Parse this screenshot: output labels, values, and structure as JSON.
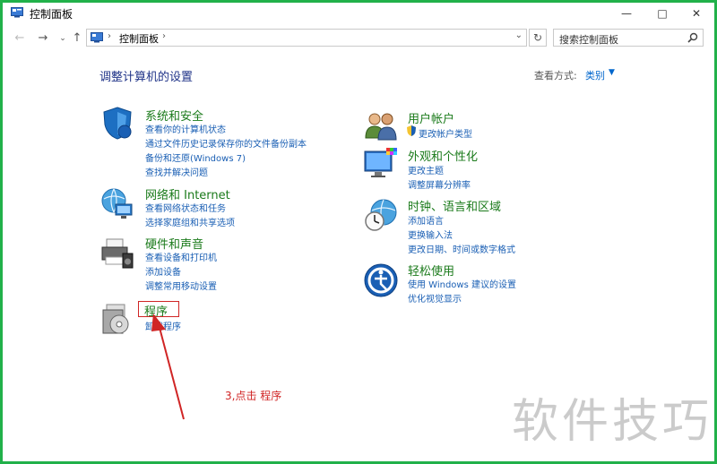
{
  "window": {
    "title": "控制面板",
    "buttons": {
      "minimize": "—",
      "maximize": "□",
      "close": "✕"
    }
  },
  "navbar": {
    "breadcrumb": "控制面板",
    "search_placeholder": "搜索控制面板"
  },
  "main": {
    "heading": "调整计算机的设置",
    "view_by_label": "查看方式:",
    "view_by_value": "类别"
  },
  "categories": [
    {
      "title": "系统和安全",
      "links": [
        "查看你的计算机状态",
        "通过文件历史记录保存你的文件备份副本",
        "备份和还原(Windows 7)",
        "查找并解决问题"
      ]
    },
    {
      "title": "网络和 Internet",
      "links": [
        "查看网络状态和任务",
        "选择家庭组和共享选项"
      ]
    },
    {
      "title": "硬件和声音",
      "links": [
        "查看设备和打印机",
        "添加设备",
        "调整常用移动设置"
      ]
    },
    {
      "title": "程序",
      "links": [
        "卸载程序"
      ]
    },
    {
      "title": "用户帐户",
      "links": [
        "更改帐户类型"
      ]
    },
    {
      "title": "外观和个性化",
      "links": [
        "更改主题",
        "调整屏幕分辨率"
      ]
    },
    {
      "title": "时钟、语言和区域",
      "links": [
        "添加语言",
        "更换输入法",
        "更改日期、时间或数字格式"
      ]
    },
    {
      "title": "轻松使用",
      "links": [
        "使用 Windows 建议的设置",
        "优化视觉显示"
      ]
    }
  ],
  "annotation": "3,点击  程序",
  "watermark": "软件技巧",
  "colors": {
    "frame": "#21b14a",
    "link": "#1a5fb4",
    "title_green": "#1a7a1a",
    "heading": "#1e3287",
    "annotation": "#d02525"
  }
}
